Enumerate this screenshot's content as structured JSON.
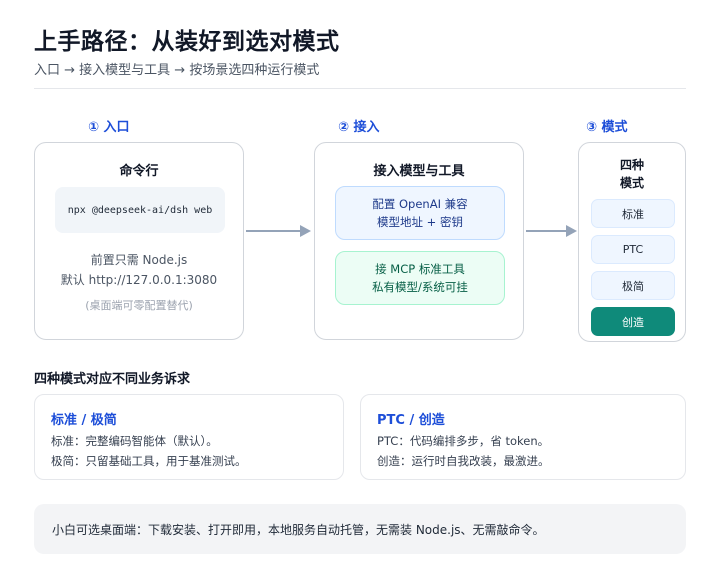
{
  "header": {
    "title": "上手路径：从装好到选对模式",
    "subtitle": "入口 → 接入模型与工具 → 按场景选四种运行模式"
  },
  "steps": [
    {
      "label": "① 入口"
    },
    {
      "label": "② 接入"
    },
    {
      "label": "③ 模式"
    }
  ],
  "entry": {
    "title": "命令行",
    "command": "npx @deepseek-ai/dsh web",
    "line1": "前置只需 Node.js",
    "line2": "默认 http://127.0.0.1:3080",
    "note": "(桌面端可零配置替代)"
  },
  "connect": {
    "title": "接入模型与工具",
    "box1": {
      "line1": "配置 OpenAI 兼容",
      "line2": "模型地址 + 密钥"
    },
    "box2": {
      "line1": "接 MCP 标准工具",
      "line2": "私有模型/系统可挂"
    }
  },
  "modes": {
    "title_line1": "四种",
    "title_line2": "模式",
    "items": [
      "标准",
      "PTC",
      "极简",
      "创造"
    ],
    "active_index": 3
  },
  "business": {
    "heading": "四种模式对应不同业务诉求",
    "cards": [
      {
        "title": "标准 / 极简",
        "line1": "标准：完整编码智能体（默认）。",
        "line2": "极简：只留基础工具，用于基准测试。"
      },
      {
        "title": "PTC / 创造",
        "line1": "PTC：代码编排多步，省 token。",
        "line2": "创造：运行时自我改装，最激进。"
      }
    ]
  },
  "footer": {
    "text": "小白可选桌面端：下载安装、打开即用，本地服务自动托管，无需装 Node.js、无需敲命令。"
  },
  "colors": {
    "accent": "#1d4ed8",
    "active_mode": "#0f8a7a",
    "arrow": "#94a3b8"
  }
}
